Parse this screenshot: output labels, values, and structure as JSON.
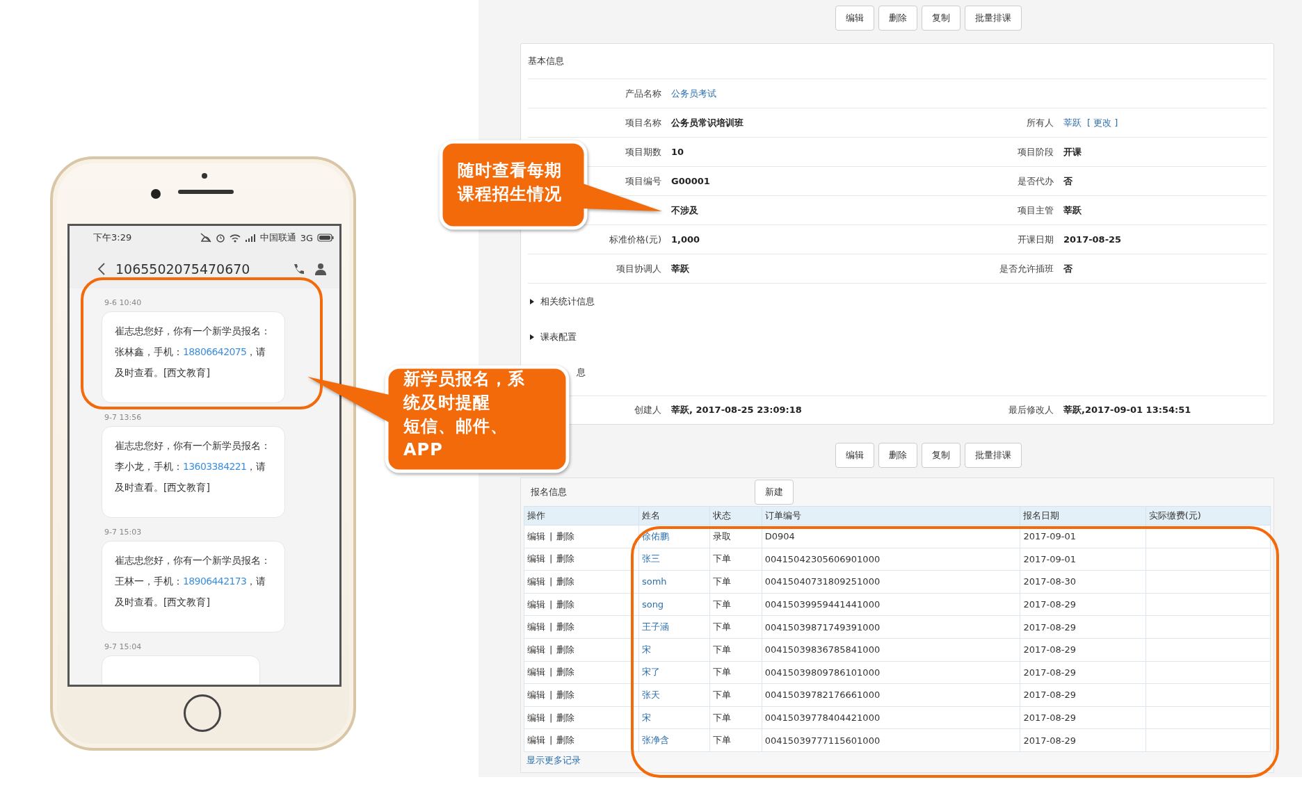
{
  "phone": {
    "status": {
      "time": "下午3:29",
      "carrier": "中国联通",
      "network": "3G"
    },
    "contact": "1065502075470670",
    "messages": [
      {
        "time": "9-6 10:40",
        "text": "崔志忠您好，你有一个新学员报名：张林鑫，手机：",
        "phone": "18806642075",
        "suffix": "，请及时查看。[西文教育]"
      },
      {
        "time": "9-7 13:56",
        "text": "崔志忠您好，你有一个新学员报名：李小龙，手机：",
        "phone": "13603384221",
        "suffix": "，请及时查看。[西文教育]"
      },
      {
        "time": "9-7 15:03",
        "text": "崔志忠您好，你有一个新学员报名：王林一，手机：",
        "phone": "18906442173",
        "suffix": "，请及时查看。[西文教育]"
      },
      {
        "time": "9-7 15:04"
      }
    ]
  },
  "web": {
    "toolbar": [
      "编辑",
      "删除",
      "复制",
      "批量排课"
    ],
    "basic_info": {
      "title": "基本信息",
      "rows": [
        [
          {
            "label": "产品名称",
            "value": "公务员考试",
            "kind": "link"
          }
        ],
        [
          {
            "label": "项目名称",
            "value": "公务员常识培训班",
            "kind": "text"
          },
          {
            "label": "所有人",
            "value": "莘跃",
            "kind": "link",
            "action": "[ 更改 ]"
          }
        ],
        [
          {
            "label": "项目期数",
            "value": "10",
            "kind": "text"
          },
          {
            "label": "项目阶段",
            "value": "开课",
            "kind": "text"
          }
        ],
        [
          {
            "label": "项目编号",
            "value": "G00001",
            "kind": "text"
          },
          {
            "label": "是否代办",
            "value": "否",
            "kind": "text"
          }
        ],
        [
          {
            "value": "不涉及",
            "kind": "text"
          },
          {
            "label": "项目主管",
            "value": "莘跃",
            "kind": "text"
          }
        ],
        [
          {
            "label": "标准价格(元)",
            "value": "1,000",
            "kind": "text"
          },
          {
            "label": "开课日期",
            "value": "2017-08-25",
            "kind": "text"
          }
        ],
        [
          {
            "label": "项目协调人",
            "value": "莘跃",
            "kind": "text"
          },
          {
            "label": "是否允许插班",
            "value": "否",
            "kind": "text"
          }
        ]
      ],
      "sections": [
        {
          "label": "相关统计信息",
          "kind": "toggle",
          "expanded": false
        },
        {
          "label": "课表配置",
          "kind": "toggle",
          "expanded": false
        },
        {
          "label": "息",
          "kind": "cut"
        }
      ],
      "footer": [
        {
          "label": "创建人",
          "value": "莘跃, 2017-08-25 23:09:18",
          "kind": "text"
        },
        {
          "label": "最后修改人",
          "value": "莘跃,2017-09-01 13:54:51",
          "kind": "text"
        }
      ]
    },
    "toolbar_bottom": [
      "编辑",
      "删除",
      "复制",
      "批量排课"
    ],
    "enrollment": {
      "title": "报名信息",
      "new_button": "新建",
      "action_separator": "|",
      "columns": [
        "操作",
        "姓名",
        "状态",
        "订单编号",
        "报名日期",
        "实际缴费(元)"
      ],
      "rows": [
        {
          "actions": [
            "编辑",
            "删除"
          ],
          "name": "徐佑鹏",
          "status": "录取",
          "order": "D0904",
          "date": "2017-09-01"
        },
        {
          "actions": [
            "编辑",
            "删除"
          ],
          "name": "张三",
          "status": "下单",
          "order": "00415042305606901000",
          "date": "2017-09-01"
        },
        {
          "actions": [
            "编辑",
            "删除"
          ],
          "name": "somh",
          "status": "下单",
          "order": "00415040731809251000",
          "date": "2017-08-30"
        },
        {
          "actions": [
            "编辑",
            "删除"
          ],
          "name": "song",
          "status": "下单",
          "order": "00415039959441441000",
          "date": "2017-08-29"
        },
        {
          "actions": [
            "编辑",
            "删除"
          ],
          "name": "王子涵",
          "status": "下单",
          "order": "00415039871749391000",
          "date": "2017-08-29"
        },
        {
          "actions": [
            "编辑",
            "删除"
          ],
          "name": "宋",
          "status": "下单",
          "order": "00415039836785841000",
          "date": "2017-08-29"
        },
        {
          "actions": [
            "编辑",
            "删除"
          ],
          "name": "宋了",
          "status": "下单",
          "order": "00415039809786101000",
          "date": "2017-08-29"
        },
        {
          "actions": [
            "编辑",
            "删除"
          ],
          "name": "张天",
          "status": "下单",
          "order": "00415039782176661000",
          "date": "2017-08-29"
        },
        {
          "actions": [
            "编辑",
            "删除"
          ],
          "name": "宋",
          "status": "下单",
          "order": "00415039778404421000",
          "date": "2017-08-29"
        },
        {
          "actions": [
            "编辑",
            "删除"
          ],
          "name": "张净含",
          "status": "下单",
          "order": "00415039777115601000",
          "date": "2017-08-29"
        }
      ],
      "more_link": "显示更多记录"
    }
  },
  "callouts": [
    {
      "lines": [
        "随时查看每期",
        "课程招生情况"
      ]
    },
    {
      "lines": [
        "新学员报名，系",
        "统及时提醒",
        "短信、邮件、",
        "APP"
      ]
    }
  ]
}
